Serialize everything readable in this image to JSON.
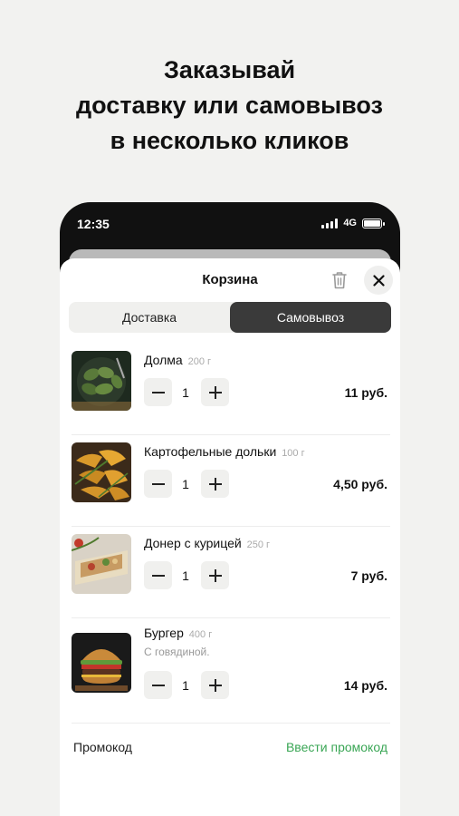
{
  "headline": {
    "line1": "Заказывай",
    "line2": "доставку или самовывоз",
    "line3": "в несколько кликов"
  },
  "status_bar": {
    "time": "12:35",
    "network": "4G",
    "icons": [
      "signal-icon",
      "battery-icon"
    ]
  },
  "cart": {
    "title": "Корзина",
    "icons": [
      "trash-icon",
      "close-icon",
      "minus-icon",
      "plus-icon"
    ],
    "tabs": [
      {
        "label": "Доставка",
        "selected": false
      },
      {
        "label": "Самовывоз",
        "selected": true
      }
    ],
    "items": [
      {
        "name": "Долма",
        "weight": "200 г",
        "description": "",
        "qty": "1",
        "price": "11 руб."
      },
      {
        "name": "Картофельные дольки",
        "weight": "100 г",
        "description": "",
        "qty": "1",
        "price": "4,50 руб."
      },
      {
        "name": "Донер с курицей",
        "weight": "250 г",
        "description": "",
        "qty": "1",
        "price": "7 руб."
      },
      {
        "name": "Бургер",
        "weight": "400 г",
        "description": "С говядиной.",
        "qty": "1",
        "price": "14 руб."
      }
    ],
    "promo": {
      "label": "Промокод",
      "action": "Ввести промокод",
      "action_color": "#3aa655"
    },
    "accent_dark": "#3a3a3a"
  }
}
